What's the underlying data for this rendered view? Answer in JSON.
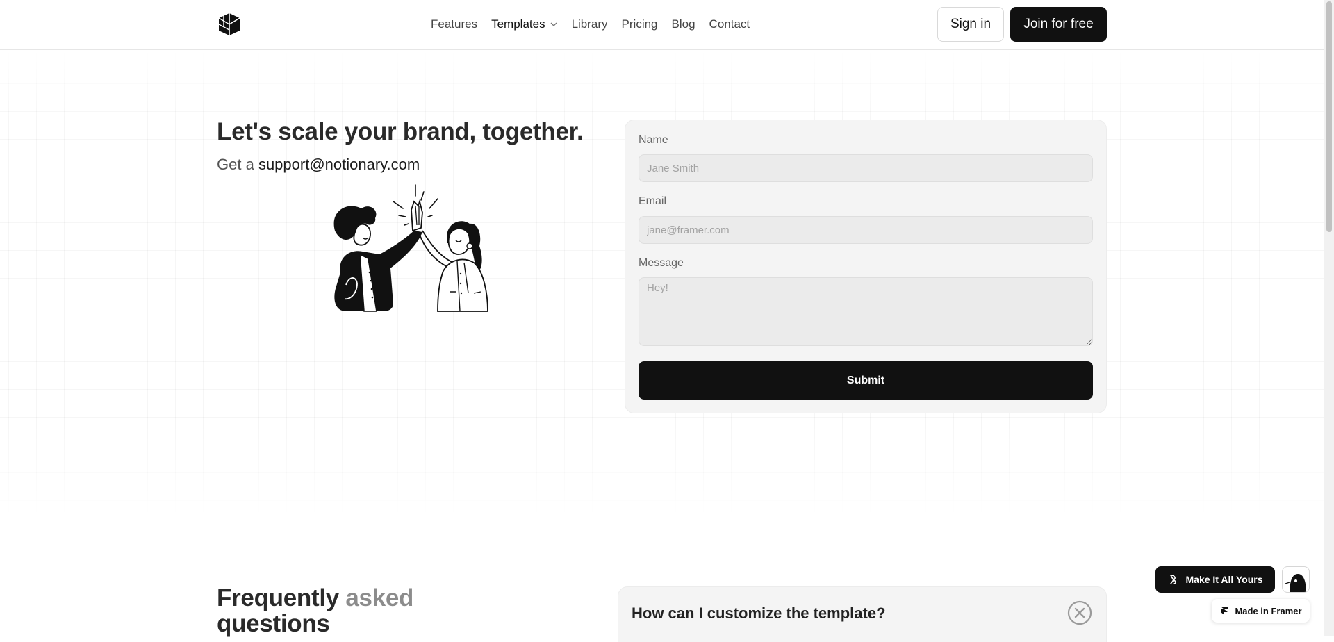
{
  "nav": {
    "logo_icon": "cube-logo-icon",
    "links": [
      {
        "label": "Features"
      },
      {
        "label": "Templates"
      },
      {
        "label": "Library"
      },
      {
        "label": "Pricing"
      },
      {
        "label": "Blog"
      },
      {
        "label": "Contact"
      }
    ],
    "sign_in_label": "Sign in",
    "join_label": "Join for free"
  },
  "hero": {
    "title": "Let's scale your brand, together.",
    "subtitle_prefix": "Get a",
    "email": "support@notionary.com",
    "illustration_icon": "high-five-illustration"
  },
  "form": {
    "name_label": "Name",
    "name_placeholder": "Jane Smith",
    "email_label": "Email",
    "email_placeholder": "jane@framer.com",
    "message_label": "Message",
    "message_placeholder": "Hey!",
    "submit_label": "Submit"
  },
  "faq": {
    "title_part1": "Frequently",
    "title_part2": "asked",
    "title_part3": "questions",
    "question": "How can I customize the template?"
  },
  "floating": {
    "make_label": "Make It All Yours",
    "framer_label": "Made in Framer"
  },
  "colors": {
    "accent": "#111111",
    "form_bg": "#f4f4f4",
    "muted_text": "#8c8c8c"
  }
}
